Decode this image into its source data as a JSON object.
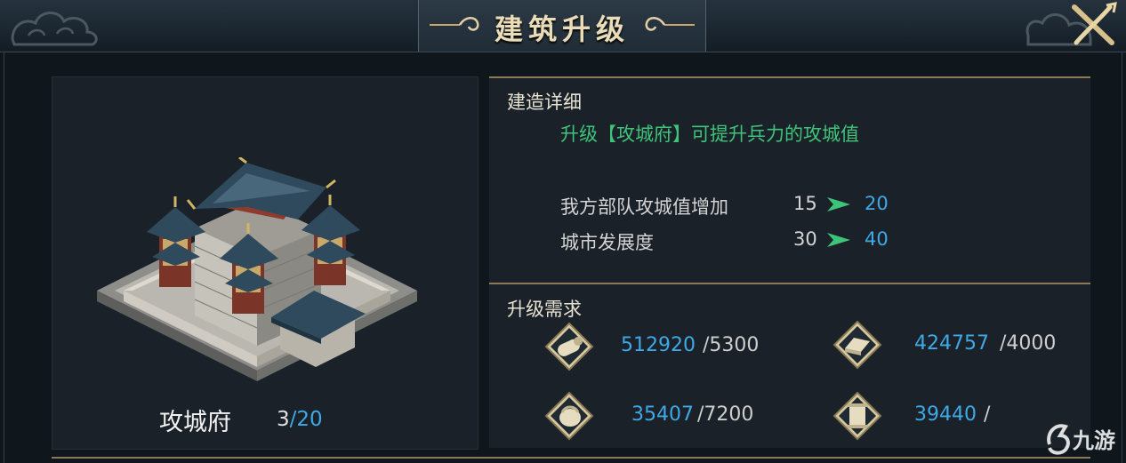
{
  "header": {
    "title": "建筑升级"
  },
  "building": {
    "name": "攻城府",
    "level_current": "3",
    "level_max": "/20"
  },
  "detail": {
    "section_title": "建造详细",
    "description": "升级【攻城府】可提升兵力的攻城值",
    "stats": [
      {
        "label": "我方部队攻城值增加",
        "from": "15",
        "to": "20"
      },
      {
        "label": "城市发展度",
        "from": "30",
        "to": "40"
      }
    ]
  },
  "requirements": {
    "section_title": "升级需求",
    "items": [
      {
        "icon": "wood-log-icon",
        "have": "512920",
        "need": "/5300"
      },
      {
        "icon": "iron-ingot-icon",
        "have": "424757",
        "need": "/4000"
      },
      {
        "icon": "grain-sack-icon",
        "have": "35407",
        "need": "/7200"
      },
      {
        "icon": "scroll-icon",
        "have": "39440",
        "need": "/"
      }
    ]
  },
  "watermark": {
    "text": "九游"
  },
  "colors": {
    "accent_blue": "#3fa9e6",
    "accent_green": "#3ec47a",
    "gold": "#c9a86a"
  }
}
